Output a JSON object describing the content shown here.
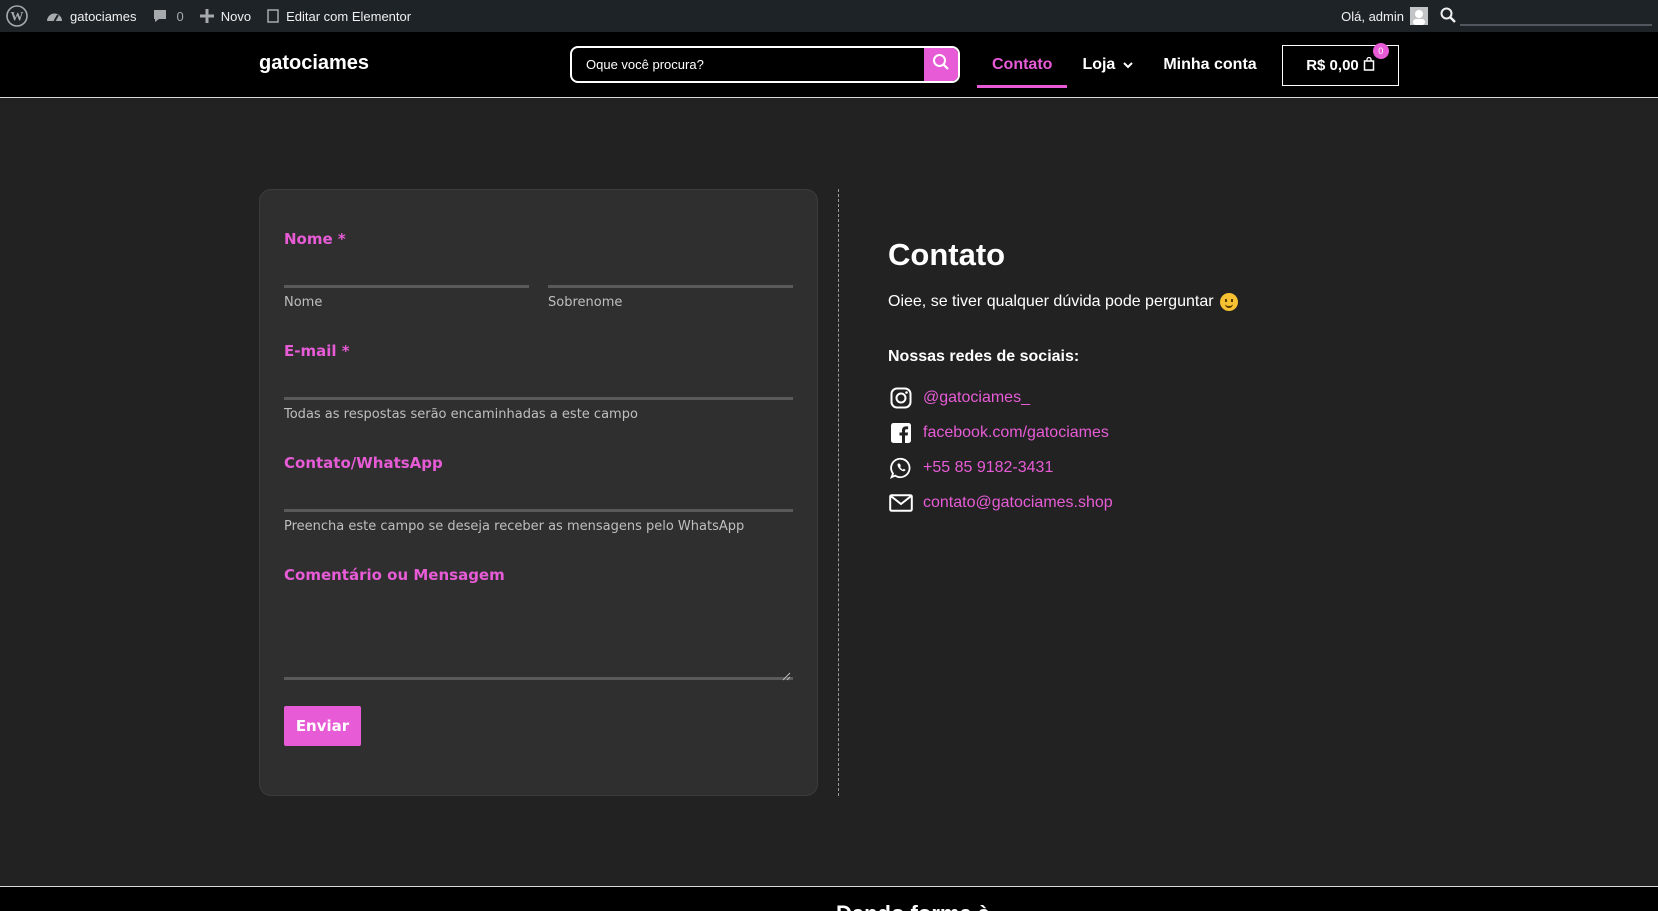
{
  "adminbar": {
    "site_name": "gatociames",
    "comments_count": "0",
    "new_label": "Novo",
    "edit_label": "Editar com Elementor",
    "greeting": "Olá, admin"
  },
  "header": {
    "logo": "gatociames",
    "search_placeholder": "Oque você procura?",
    "nav": [
      {
        "label": "Contato",
        "active": true
      },
      {
        "label": "Loja"
      },
      {
        "label": "Minha conta"
      }
    ],
    "cart_total": "R$ 0,00",
    "cart_count": "0"
  },
  "form": {
    "name_label": "Nome",
    "required_mark": "*",
    "first_name_hint": "Nome",
    "last_name_hint": "Sobrenome",
    "email_label": "E-mail",
    "email_hint": "Todas as respostas serão encaminhadas a este campo",
    "whatsapp_label": "Contato/WhatsApp",
    "whatsapp_hint": "Preencha este campo se deseja receber as mensagens pelo WhatsApp",
    "message_label": "Comentário ou Mensagem",
    "submit_label": "Enviar"
  },
  "contact": {
    "title": "Contato",
    "text": "Oiee, se tiver qualquer dúvida pode perguntar",
    "social_title": "Nossas redes de sociais:",
    "instagram": "@gatociames_",
    "facebook": "facebook.com/gatociames",
    "whatsapp": "+55 85 9182-3431",
    "email": "contato@gatociames.shop"
  },
  "colors": {
    "accent": "#e75cd6",
    "background": "#222222",
    "card": "#2f2f2f",
    "header": "#000000",
    "adminbar": "#1d2327"
  },
  "footer": {
    "title": "Dando forma à..."
  }
}
